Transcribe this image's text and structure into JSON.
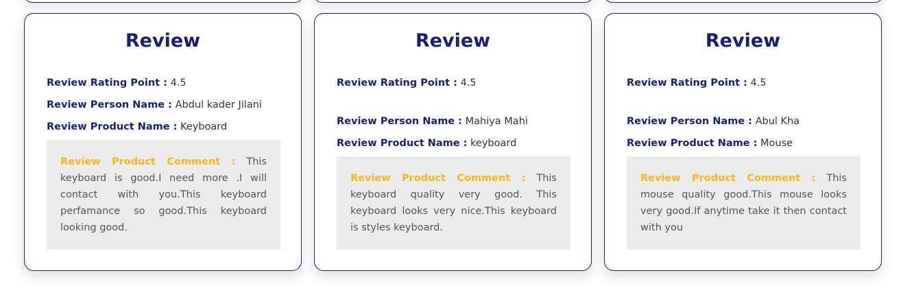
{
  "reviews": [
    {
      "title": "Review",
      "rating_label": "Review Rating Point :",
      "rating": "4.5",
      "person_label": "Review Person Name :",
      "person": "Abdul kader Jilani",
      "product_label": "Review Product Name :",
      "product": "Keyboard",
      "comment_label": "Review Product Comment :",
      "comment": "This keyboard is good.I need more .I will contact with you.This keyboard perfamance so good.This keyboard looking good."
    },
    {
      "title": "Review",
      "rating_label": "Review Rating Point :",
      "rating": "4.5",
      "person_label": "Review Person Name :",
      "person": "Mahiya Mahi",
      "product_label": "Review Product Name :",
      "product": "keyboard",
      "comment_label": "Review Product Comment :",
      "comment": "This keyboard quality very good. This keyboard looks very nice.This keyboard is styles keyboard."
    },
    {
      "title": "Review",
      "rating_label": "Review Rating Point :",
      "rating": "4.5",
      "person_label": "Review Person Name :",
      "person": "Abul Kha",
      "product_label": "Review Product Name :",
      "product": "Mouse",
      "comment_label": "Review Product Comment :",
      "comment": "This mouse quality good.This mouse looks very good.If anytime take it then contact with you"
    }
  ]
}
